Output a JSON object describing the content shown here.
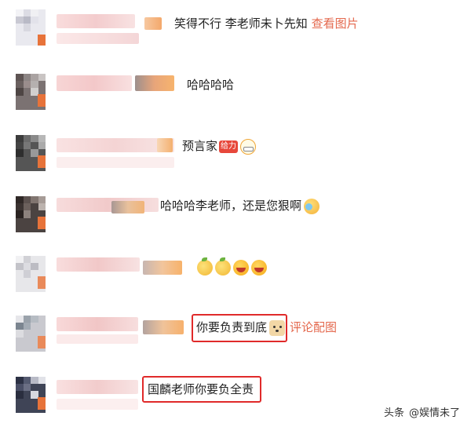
{
  "comments": [
    {
      "text": "笑得不行 李老师未卜先知",
      "link": "查看图片"
    },
    {
      "text": "哈哈哈哈"
    },
    {
      "text": "预言家",
      "badge": "给力"
    },
    {
      "text": "哈哈哈李老师，还是您狠啊"
    },
    {
      "text": ""
    },
    {
      "text": "你要负责到底",
      "link": "评论配图"
    },
    {
      "text": "国麟老师你要负全责"
    }
  ],
  "watermark": {
    "prefix": "头条",
    "handle": "@娱情未了"
  },
  "colors": {
    "link": "#e4684d",
    "highlight_box": "#e02a2a",
    "avatar_accent": "#e7733a"
  }
}
